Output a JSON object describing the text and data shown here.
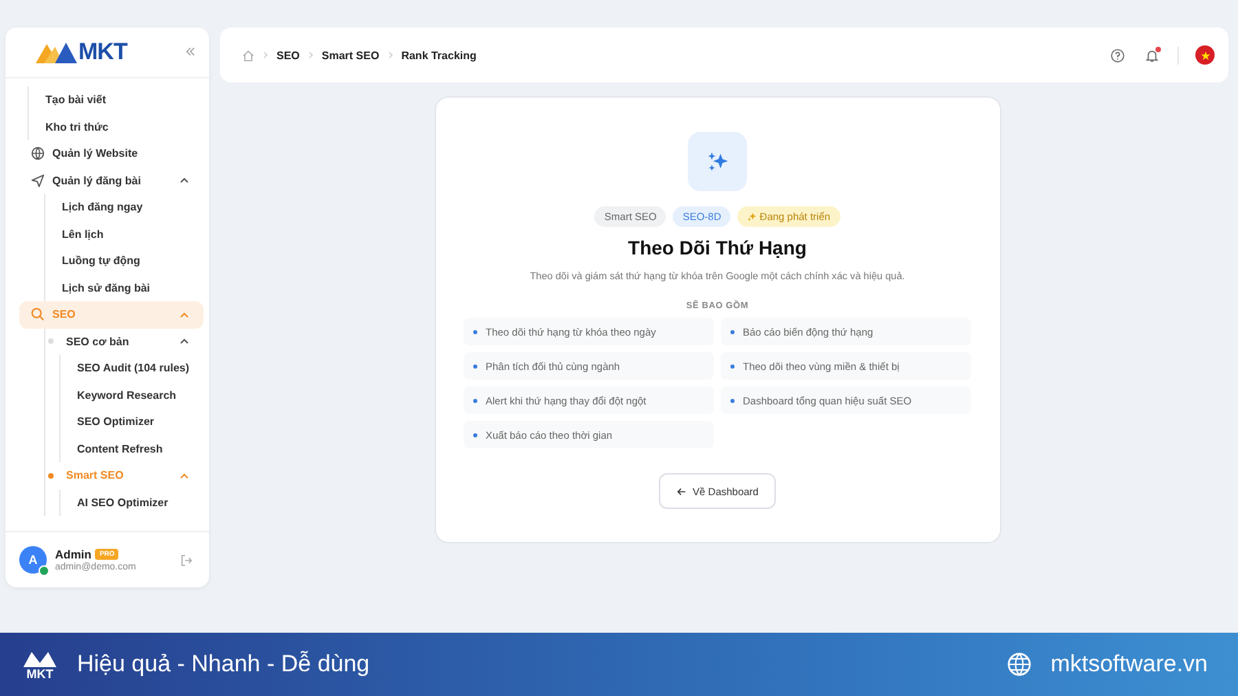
{
  "sidebar": {
    "logo": "MKT",
    "items": [
      {
        "children": [
          {
            "label": "Tạo bài viết",
            "selected": false
          },
          {
            "label": "Kho tri thức",
            "selected": false
          }
        ]
      },
      {
        "label": "Quản lý Website",
        "kind": "website",
        "selected": false
      },
      {
        "label": "Quản lý đăng bài",
        "kind": "posting",
        "selected": false,
        "expanded": true,
        "children": [
          {
            "label": "Lịch đăng ngay",
            "selected": false
          },
          {
            "label": "Lên lịch",
            "selected": false
          },
          {
            "label": "Luồng tự động",
            "selected": false
          },
          {
            "label": "Lịch sử đăng bài",
            "selected": false
          }
        ]
      },
      {
        "label": "SEO",
        "kind": "seo",
        "selected": true,
        "expanded": true,
        "children": [
          {
            "label": "SEO cơ bản",
            "selected": false,
            "expanded": true,
            "children": [
              {
                "label": "SEO Audit (104 rules)",
                "selected": false
              },
              {
                "label": "Keyword Research",
                "selected": false
              },
              {
                "label": "SEO Optimizer",
                "selected": false
              },
              {
                "label": "Content Refresh",
                "selected": false
              }
            ]
          },
          {
            "label": "Smart SEO",
            "selected": true,
            "expanded": true,
            "children": [
              {
                "label": "AI SEO Optimizer",
                "selected": false
              }
            ]
          }
        ]
      }
    ],
    "user": {
      "avatar": "A",
      "name": "Admin",
      "badge": "PRO",
      "email": "admin@demo.com",
      "online": true
    }
  },
  "topbar": {
    "breadcrumbs": [
      "SEO",
      "Smart SEO",
      "Rank Tracking"
    ],
    "notification_dot": true
  },
  "card": {
    "tags": [
      {
        "label": "Smart SEO",
        "kind": "category"
      },
      {
        "label": "SEO-8D",
        "kind": "code"
      },
      {
        "label": "Đang phát triển",
        "kind": "status"
      }
    ],
    "title": "Theo Dõi Thứ Hạng",
    "description": "Theo dõi và giám sát thứ hạng từ khóa trên Google một cách chính xác và hiệu quả.",
    "section": "SẼ BAO GỒM",
    "features": [
      "Theo dõi thứ hạng từ khóa theo ngày",
      "Báo cáo biến động thứ hạng",
      "Phân tích đối thủ cùng ngành",
      "Theo dõi theo vùng miền & thiết bị",
      "Alert khi thứ hạng thay đổi đột ngột",
      "Dashboard tổng quan hiệu suất SEO",
      "Xuất báo cáo theo thời gian"
    ],
    "button": "Về Dashboard"
  },
  "banner": {
    "logo": "MKT",
    "slogan": "Hiệu quả - Nhanh - Dễ dùng",
    "website": "mktsoftware.vn"
  }
}
